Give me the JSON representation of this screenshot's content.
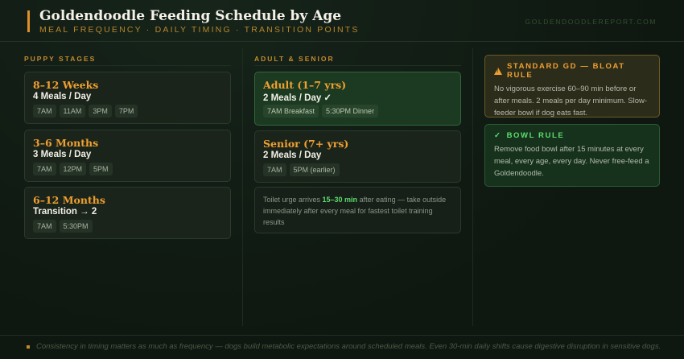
{
  "header": {
    "title": "Goldendoodle Feeding Schedule by Age",
    "subtitle": "MEAL FREQUENCY · DAILY TIMING · TRANSITION POINTS",
    "site": "GOLDENDOODLEREPORT.COM"
  },
  "puppy": {
    "label": "PUPPY STAGES",
    "cards": [
      {
        "title": "8–12 Weeks",
        "sub": "4 Meals / Day",
        "times": [
          "7AM",
          "11AM",
          "3PM",
          "7PM"
        ]
      },
      {
        "title": "3–6 Months",
        "sub": "3 Meals / Day",
        "times": [
          "7AM",
          "12PM",
          "5PM"
        ]
      },
      {
        "title": "6–12 Months",
        "sub": "Transition → 2",
        "times": [
          "7AM",
          "5:30PM"
        ]
      }
    ]
  },
  "adult": {
    "label": "ADULT & SENIOR",
    "cards": [
      {
        "title": "Adult (1–7 yrs)",
        "sub": "2 Meals / Day ✓",
        "times": [
          "7AM Breakfast",
          "5:30PM Dinner"
        ]
      },
      {
        "title": "Senior (7+ yrs)",
        "sub": "2 Meals / Day",
        "times": [
          "7AM",
          "5PM (earlier)"
        ]
      }
    ],
    "note_before": "Toilet urge arrives ",
    "note_highlight": "15–30 min",
    "note_after": " after eating — take outside immediately after every meal for fastest toilet training results"
  },
  "rules": {
    "bloat": {
      "icon": "warning-icon",
      "title": "STANDARD GD — BLOAT RULE",
      "body": "No vigorous exercise 60–90 min before or after meals. 2 meals per day minimum. Slow-feeder bowl if dog eats fast."
    },
    "bowl": {
      "icon": "check-icon",
      "title": "BOWL RULE",
      "body": "Remove food bowl after 15 minutes at every meal, every age, every day. Never free-feed a Goldendoodle."
    }
  },
  "footer": {
    "text": "Consistency in timing matters as much as frequency — dogs build metabolic expectations around scheduled meals. Even 30-min daily shifts cause digestive disruption in sensitive dogs."
  },
  "colors": {
    "accent": "#f0a030",
    "success": "#5ddc6e",
    "background": "#0f1a12"
  }
}
